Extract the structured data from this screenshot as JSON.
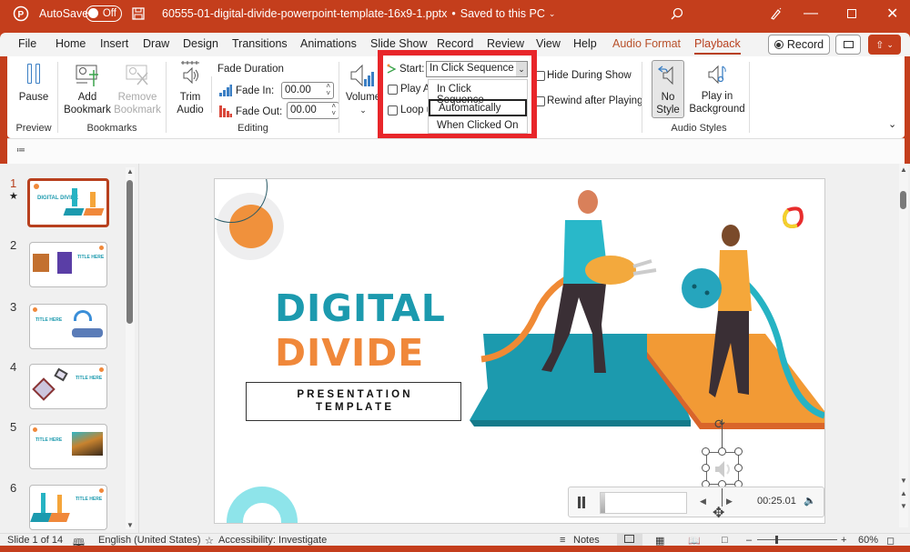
{
  "titlebar": {
    "autosave_label": "AutoSave",
    "autosave_state": "Off",
    "filename": "60555-01-digital-divide-powerpoint-template-16x9-1.pptx",
    "save_status": "Saved to this PC",
    "icons": [
      "powerpoint-logo-icon",
      "save-icon",
      "search-icon",
      "designer-pen-icon",
      "minimize-icon",
      "maximize-icon",
      "close-icon"
    ]
  },
  "menubar": {
    "tabs": [
      "File",
      "Home",
      "Insert",
      "Draw",
      "Design",
      "Transitions",
      "Animations",
      "Slide Show",
      "Record",
      "Review",
      "View",
      "Help",
      "Audio Format",
      "Playback"
    ],
    "active_tab": "Playback",
    "record_button": "Record",
    "comments_icon": "comment-icon",
    "share_icon": "share-icon"
  },
  "ribbon": {
    "preview": {
      "pause": "Pause",
      "group": "Preview"
    },
    "bookmarks": {
      "add": "Add Bookmark",
      "add_l1": "Add",
      "add_l2": "Bookmark",
      "remove_l1": "Remove",
      "remove_l2": "Bookmark",
      "group": "Bookmarks"
    },
    "editing": {
      "trim_l1": "Trim",
      "trim_l2": "Audio",
      "fade_duration": "Fade Duration",
      "fade_in_label": "Fade In:",
      "fade_in_value": "00.00",
      "fade_out_label": "Fade Out:",
      "fade_out_value": "00.00",
      "group": "Editing"
    },
    "audio_options": {
      "volume": "Volume",
      "start_label": "Start:",
      "start_value": "In Click Sequence",
      "start_options": [
        "In Click Sequence",
        "Automatically",
        "When Clicked On"
      ],
      "highlighted_option": "Automatically",
      "play_across": "Play A",
      "loop": "Loop u",
      "hide_during_show": "Hide During Show",
      "rewind_after_playing": "Rewind after Playing"
    },
    "audio_styles": {
      "no_style_l1": "No",
      "no_style_l2": "Style",
      "play_bg_l1": "Play in",
      "play_bg_l2": "Background",
      "group": "Audio Styles"
    }
  },
  "thumbnails": [
    {
      "num": "1",
      "selected": true,
      "has_animation": true,
      "title": "DIGITAL DIVIDE"
    },
    {
      "num": "2",
      "selected": false,
      "title": "TITLE HERE"
    },
    {
      "num": "3",
      "selected": false,
      "title": "TITLE HERE"
    },
    {
      "num": "4",
      "selected": false,
      "title": "TITLE HERE"
    },
    {
      "num": "5",
      "selected": false,
      "title": "TITLE HERE"
    },
    {
      "num": "6",
      "selected": false,
      "title": "TITLE HERE"
    }
  ],
  "slide": {
    "title_line1": "DIGITAL",
    "title_line2": "DIVIDE",
    "subtitle_line1": "P R E S E N T A T I O N",
    "subtitle_line2": "T E M P L A T E",
    "colors": {
      "teal": "#1c9aae",
      "orange": "#f0883a",
      "light_teal": "#8ee4ea"
    }
  },
  "audio_player": {
    "time": "00:25.01",
    "progress": 0.05
  },
  "statusbar": {
    "slide_info": "Slide 1 of 14",
    "language": "English (United States)",
    "accessibility": "Accessibility: Investigate",
    "notes": "Notes",
    "zoom": "60%",
    "zoom_level": 0.6
  }
}
